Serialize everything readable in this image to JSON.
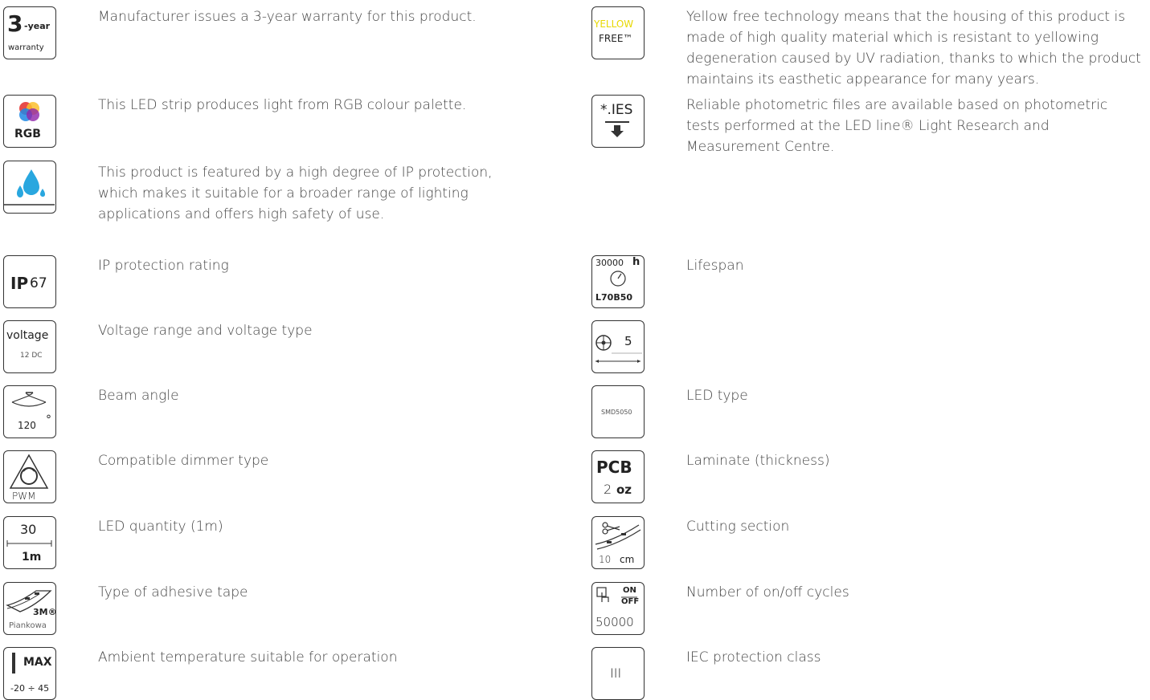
{
  "left": {
    "warranty": {
      "icon_number": "3",
      "icon_suffix": "-year",
      "icon_label": "warranty",
      "text": "Manufacturer issues a 3-year warranty for this product."
    },
    "rgb": {
      "icon_label": "RGB",
      "text": "This LED strip produces light from RGB colour palette."
    },
    "ip_protection": {
      "text": "This product is featured by a high degree of IP protection, which makes it suitable for a broader range of lighting applications and offers high safety of use."
    },
    "ip_rating": {
      "icon_ip": "IP",
      "icon_value": "67",
      "text": "IP protection rating"
    },
    "voltage": {
      "icon_label": "voltage",
      "icon_value": "12 DC",
      "text": "Voltage range and voltage type"
    },
    "beam_angle": {
      "icon_value": "120",
      "icon_unit": "°",
      "text": "Beam angle"
    },
    "dimmer": {
      "icon_label": "PWM",
      "text": "Compatible dimmer type"
    },
    "led_quantity": {
      "icon_value": "30",
      "icon_unit": "1m",
      "text": "LED quantity (1m)"
    },
    "adhesive": {
      "icon_brand": "3M®",
      "icon_label": "Piankowa",
      "text": "Type of adhesive tape"
    },
    "temperature": {
      "icon_label": "MAX",
      "icon_value": "-20 ÷ 45",
      "text": "Ambient temperature suitable for operation"
    }
  },
  "right": {
    "yellow_free": {
      "icon_line1": "YELLOW",
      "icon_line2": "FREE™",
      "text": "Yellow free technology means that the housing of this product is made of high quality material which is resistant to yellowing degeneration caused by UV radiation, thanks to which the product maintains its easthetic appearance for many years."
    },
    "ies": {
      "icon_label": "*.IES",
      "text": "Reliable photometric files are available based on photometric tests performed at the LED line® Light Research and Measurement Centre."
    },
    "lifespan": {
      "icon_value": "30000",
      "icon_unit": "h",
      "icon_label": "L70B50",
      "text": "Lifespan"
    },
    "length": {
      "icon_value": "5",
      "text": ""
    },
    "led_type": {
      "icon_label": "SMD5050",
      "text": "LED type"
    },
    "laminate": {
      "icon_label": "PCB",
      "icon_value": "2",
      "icon_unit": "oz",
      "text": "Laminate (thickness)"
    },
    "cutting": {
      "icon_value": "10",
      "icon_unit": "cm",
      "text": "Cutting section"
    },
    "cycles": {
      "icon_on": "ON",
      "icon_off": "OFF",
      "icon_value": "50000",
      "text": "Number of on/off cycles"
    },
    "iec": {
      "icon_label": "III",
      "text": "IEC protection class"
    }
  },
  "colors": {
    "yellow": "#e8d800",
    "rgb_red": "#e53935",
    "rgb_green": "#43a047",
    "rgb_blue": "#1e88e5",
    "water_blue": "#29a7df"
  }
}
